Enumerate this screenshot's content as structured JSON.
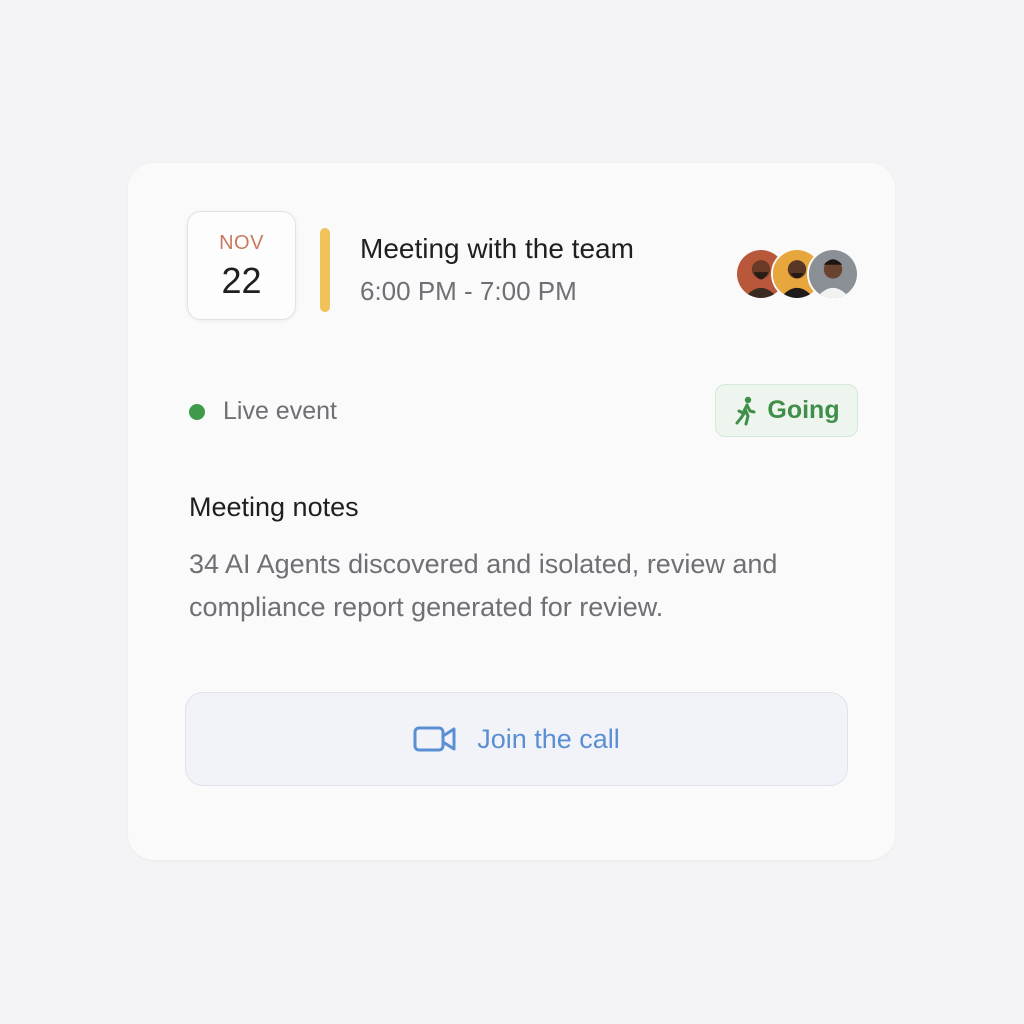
{
  "event": {
    "month": "NOV",
    "day": "22",
    "title": "Meeting with the team",
    "time": "6:00 PM - 7:00 PM",
    "accent_color": "#f0c25a"
  },
  "attendees": [
    {
      "icon": "avatar-1",
      "bg": "#b8573a"
    },
    {
      "icon": "avatar-2",
      "bg": "#e7a73c"
    },
    {
      "icon": "avatar-3",
      "bg": "#8a9096"
    }
  ],
  "status": {
    "live_label": "Live event",
    "live_color": "#3f9a4c",
    "rsvp_label": "Going",
    "rsvp_icon": "walking-person-icon",
    "rsvp_color": "#3f8f4a"
  },
  "notes": {
    "title": "Meeting notes",
    "body": "34 AI Agents discovered and isolated, review and compliance report generated for review."
  },
  "call": {
    "label": "Join the call",
    "icon": "video-camera-icon",
    "color": "#5b8fd4"
  }
}
